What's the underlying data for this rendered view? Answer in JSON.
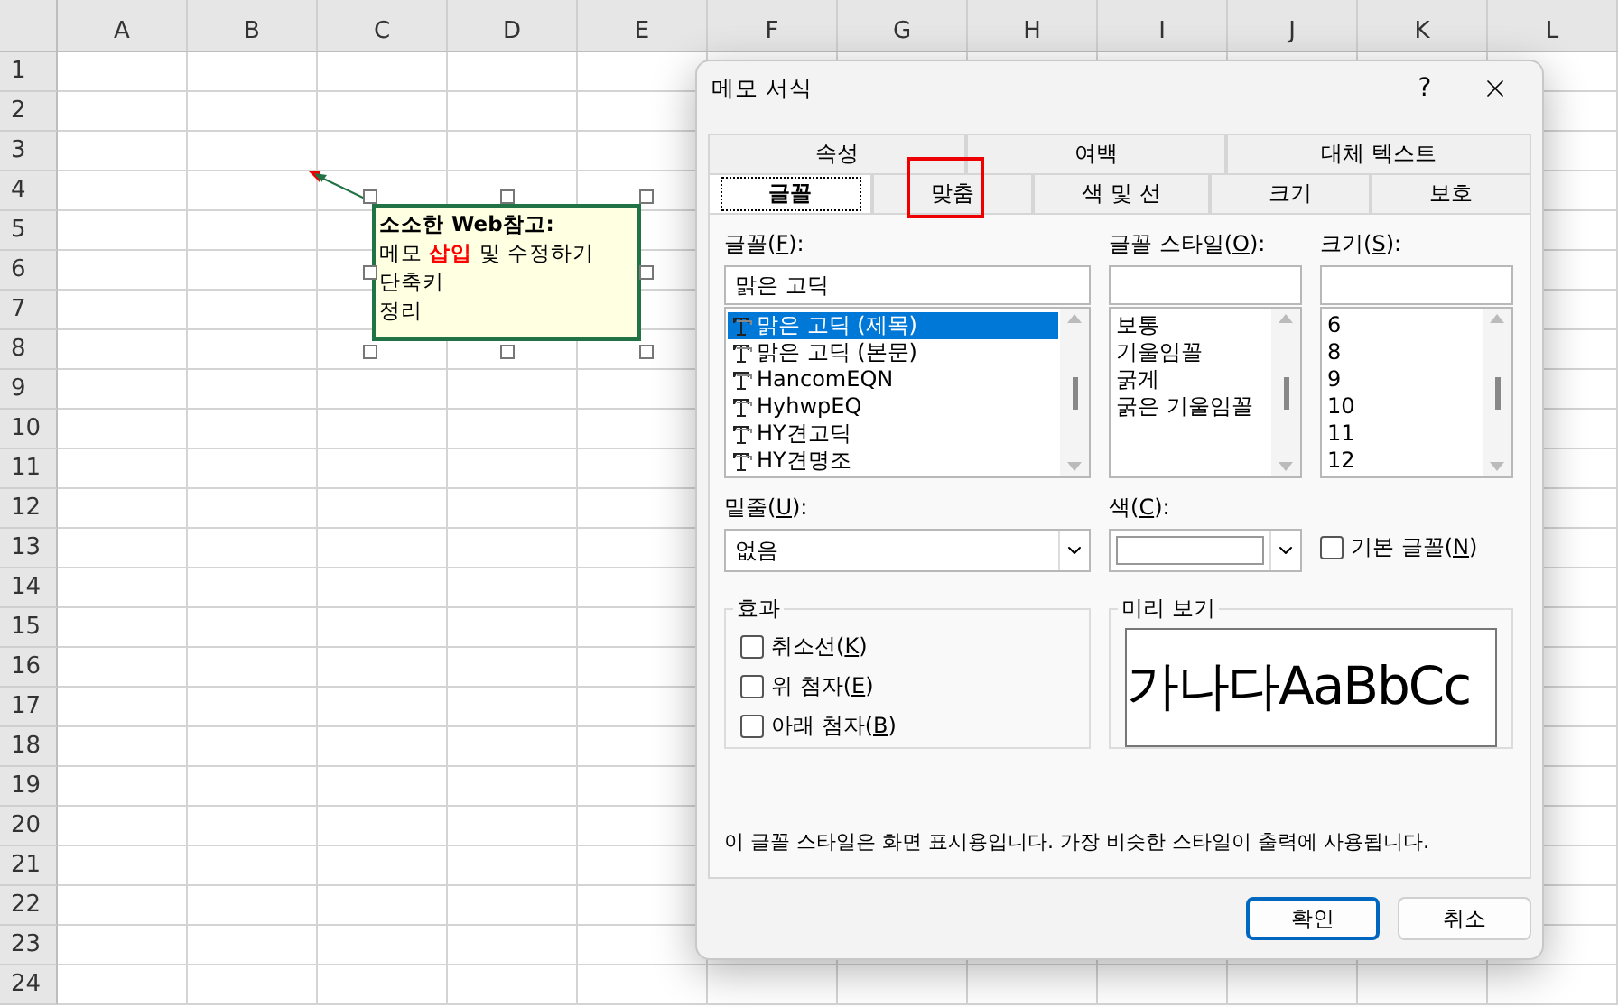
{
  "sheet": {
    "columns": [
      "A",
      "B",
      "C",
      "D",
      "E",
      "F",
      "G",
      "H",
      "I",
      "J",
      "K",
      "L"
    ],
    "rows": [
      "1",
      "2",
      "3",
      "4",
      "5",
      "6",
      "7",
      "8",
      "9",
      "10",
      "11",
      "12",
      "13",
      "14",
      "15",
      "16",
      "17",
      "18",
      "19",
      "20",
      "21",
      "22",
      "23",
      "24"
    ],
    "comment": {
      "selected": true,
      "lines": [
        [
          {
            "text": "소소한 Web참고:",
            "emphasis": false
          }
        ],
        [
          {
            "text": "메모 ",
            "emphasis": false
          },
          {
            "text": "삽입",
            "emphasis": true
          },
          {
            "text": " 및 수정하기",
            "emphasis": false
          }
        ],
        [
          {
            "text": "단축키",
            "emphasis": false
          }
        ],
        [
          {
            "text": "정리",
            "emphasis": false
          }
        ]
      ]
    }
  },
  "dialog": {
    "title": "메모 서식",
    "help": "?",
    "tabs_back": [
      {
        "label": "속성",
        "selected": false
      },
      {
        "label": "여백",
        "selected": false
      },
      {
        "label": "대체 텍스트",
        "selected": false
      }
    ],
    "tabs_front": [
      {
        "label": "글꼴",
        "selected": true,
        "highlighted": false
      },
      {
        "label": "맞춤",
        "selected": false,
        "highlighted": true
      },
      {
        "label": "색 및 선",
        "selected": false,
        "highlighted": false
      },
      {
        "label": "크기",
        "selected": false,
        "highlighted": false
      },
      {
        "label": "보호",
        "selected": false,
        "highlighted": false
      }
    ],
    "font": {
      "label": [
        "글꼴(",
        "F",
        "):"
      ],
      "value": "맑은 고딕",
      "items": [
        {
          "name": "맑은 고딕 (제목)",
          "selected": true
        },
        {
          "name": "맑은 고딕 (본문)",
          "selected": false
        },
        {
          "name": "HancomEQN",
          "selected": false
        },
        {
          "name": "HyhwpEQ",
          "selected": false
        },
        {
          "name": "HY견고딕",
          "selected": false
        },
        {
          "name": "HY견명조",
          "selected": false
        }
      ]
    },
    "style": {
      "label": [
        "글꼴 스타일(",
        "O",
        "):"
      ],
      "items": [
        {
          "name": "보통",
          "selected": false
        },
        {
          "name": "기울임꼴",
          "selected": false
        },
        {
          "name": "굵게",
          "selected": false
        },
        {
          "name": "굵은 기울임꼴",
          "selected": false
        }
      ]
    },
    "size": {
      "label": [
        "크기(",
        "S",
        "):"
      ],
      "items": [
        {
          "name": "6",
          "selected": false
        },
        {
          "name": "8",
          "selected": false
        },
        {
          "name": "9",
          "selected": false
        },
        {
          "name": "10",
          "selected": false
        },
        {
          "name": "11",
          "selected": false
        },
        {
          "name": "12",
          "selected": false
        }
      ]
    },
    "underline": {
      "label": [
        "밑줄(",
        "U",
        "):"
      ],
      "value": "없음"
    },
    "color": {
      "label": [
        "색(",
        "C",
        "):"
      ]
    },
    "default_font": {
      "label": [
        "기본 글꼴(",
        "N",
        ")"
      ],
      "checked": false
    },
    "effects": {
      "title": "효과",
      "items": [
        {
          "label": [
            "취소선(",
            "K",
            ")"
          ],
          "checked": false
        },
        {
          "label": [
            "위 첨자(",
            "E",
            ")"
          ],
          "checked": false
        },
        {
          "label": [
            "아래 첨자(",
            "B",
            ")"
          ],
          "checked": false
        }
      ]
    },
    "preview": {
      "title": "미리 보기",
      "sample": "가나다AaBbCc"
    },
    "note": "이 글꼴 스타일은 화면 표시용입니다. 가장 비슷한 스타일이 출력에 사용됩니다.",
    "buttons": [
      {
        "label": "확인",
        "default": true
      },
      {
        "label": "취소",
        "default": false
      }
    ]
  }
}
